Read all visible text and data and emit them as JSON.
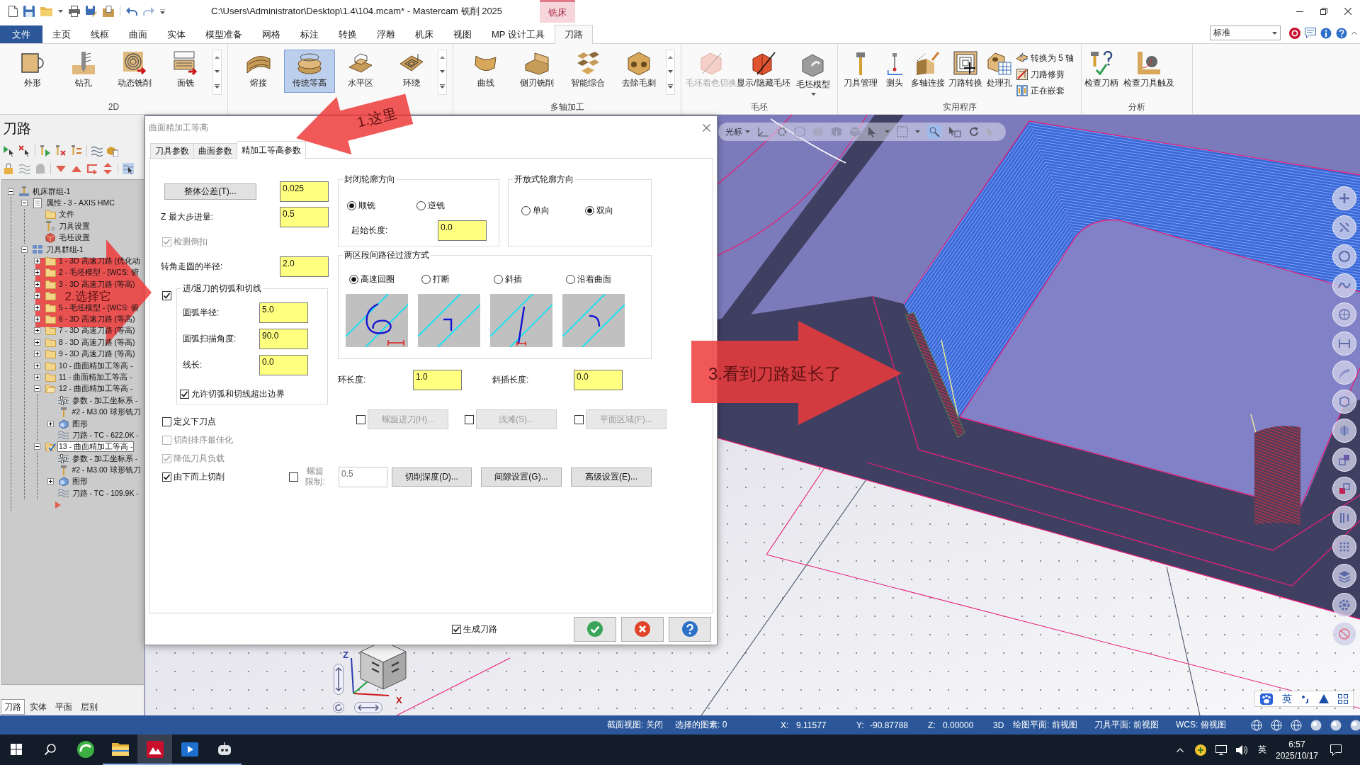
{
  "title_bar": {
    "title": "C:\\Users\\Administrator\\Desktop\\1.4\\104.mcam* - Mastercam 铣削 2025",
    "context_tab": "铣床"
  },
  "menu_tabs": [
    {
      "label": "文件",
      "kind": "file",
      "selected": false
    },
    {
      "label": "主页",
      "kind": "tab",
      "selected": false
    },
    {
      "label": "线框",
      "kind": "tab",
      "selected": false
    },
    {
      "label": "曲面",
      "kind": "tab",
      "selected": false
    },
    {
      "label": "实体",
      "kind": "tab",
      "selected": false
    },
    {
      "label": "模型准备",
      "kind": "tab",
      "selected": false
    },
    {
      "label": "网格",
      "kind": "tab",
      "selected": false
    },
    {
      "label": "标注",
      "kind": "tab",
      "selected": false
    },
    {
      "label": "转换",
      "kind": "tab",
      "selected": false
    },
    {
      "label": "浮雕",
      "kind": "tab",
      "selected": false
    },
    {
      "label": "机床",
      "kind": "tab",
      "selected": false
    },
    {
      "label": "视图",
      "kind": "tab",
      "selected": false
    },
    {
      "label": "MP 设计工具",
      "kind": "tab",
      "selected": false
    },
    {
      "label": "刀路",
      "kind": "tab",
      "selected": true
    }
  ],
  "workspace": {
    "value": "标准"
  },
  "ribbon": [
    {
      "label": "2D",
      "buttons": [
        {
          "label": "外形",
          "kind": "large",
          "selected": false,
          "disabled": false
        },
        {
          "label": "钻孔",
          "kind": "large",
          "selected": false,
          "disabled": false
        },
        {
          "label": "动态铣削",
          "kind": "large",
          "selected": false,
          "disabled": false
        },
        {
          "label": "面铣",
          "kind": "large",
          "selected": false,
          "disabled": false
        }
      ]
    },
    {
      "buttons": [
        {
          "label": "熔接",
          "kind": "large",
          "selected": false,
          "disabled": false
        },
        {
          "label": "传统等高",
          "kind": "large",
          "selected": true,
          "disabled": false
        },
        {
          "label": "水平区",
          "kind": "large",
          "selected": false,
          "disabled": false
        },
        {
          "label": "环绕",
          "kind": "large",
          "selected": false,
          "disabled": false
        }
      ]
    },
    {
      "label": "多轴加工",
      "buttons": [
        {
          "label": "曲线",
          "kind": "large",
          "selected": false,
          "disabled": false
        },
        {
          "label": "侧刃铣削",
          "kind": "large",
          "selected": false,
          "disabled": false
        },
        {
          "label": "智能综合",
          "kind": "large",
          "selected": false,
          "disabled": false
        },
        {
          "label": "去除毛刺",
          "kind": "large",
          "selected": false,
          "disabled": false
        }
      ]
    },
    {
      "label": "毛坯",
      "buttons": [
        {
          "label": "毛坯着色切换",
          "kind": "large",
          "selected": false,
          "disabled": true
        },
        {
          "label": "显示/隐藏毛坯",
          "kind": "large",
          "selected": false,
          "disabled": false
        },
        {
          "label": "毛坯模型",
          "kind": "split",
          "selected": false,
          "disabled": false
        }
      ]
    },
    {
      "label": "实用程序",
      "buttons": [
        {
          "label": "刀具管理",
          "kind": "large",
          "selected": false,
          "disabled": false
        },
        {
          "label": "测头",
          "kind": "large",
          "selected": false,
          "disabled": false
        },
        {
          "label": "多轴连接",
          "kind": "large",
          "selected": false,
          "disabled": false
        },
        {
          "label": "刀路转换",
          "kind": "large",
          "selected": false,
          "disabled": false
        },
        {
          "label": "处理孔",
          "kind": "large",
          "selected": false,
          "disabled": false
        },
        {
          "label": "转换为 5 轴",
          "kind": "small",
          "selected": false,
          "disabled": false
        },
        {
          "label": "刀路修剪",
          "kind": "small",
          "selected": false,
          "disabled": false
        },
        {
          "label": "正在嵌套",
          "kind": "small",
          "selected": false,
          "disabled": false
        }
      ]
    },
    {
      "label": "分析",
      "buttons": [
        {
          "label": "检查刀柄",
          "kind": "large",
          "selected": false,
          "disabled": false
        },
        {
          "label": "检查刀具触及",
          "kind": "large",
          "selected": false,
          "disabled": false
        }
      ]
    }
  ],
  "toolpath_panel": {
    "title": "刀路",
    "tree": [
      {
        "label": "机床群组-1",
        "kind": "machine",
        "expanded": true,
        "children": [
          {
            "label": "属性 - 3 - AXIS HMC",
            "kind": "properties",
            "expanded": true,
            "children": [
              {
                "label": "文件",
                "kind": "folder"
              },
              {
                "label": "刀具设置",
                "kind": "tool_settings"
              },
              {
                "label": "毛坯设置",
                "kind": "stock"
              }
            ]
          },
          {
            "label": "刀具群组-1",
            "kind": "group",
            "expanded": true,
            "children": [
              {
                "label": "1 - 3D 高速刀路 (优化动",
                "kind": "operation",
                "expanded": false,
                "checked": false,
                "selected": false
              },
              {
                "label": "2 - 毛坯模型 - [WCS: 俯",
                "kind": "operation",
                "expanded": false,
                "checked": false,
                "selected": false
              },
              {
                "label": "3 - 3D 高速刀路 (等高)",
                "kind": "operation",
                "expanded": false,
                "checked": false,
                "selected": false
              },
              {
                "kind": "operation",
                "expanded": false,
                "checked": false,
                "selected": false
              },
              {
                "label": "5 - 毛坯模型 - [WCS: 俯",
                "kind": "operation",
                "expanded": false,
                "checked": false,
                "selected": false
              },
              {
                "label": "6 - 3D 高速刀路 (等高)",
                "kind": "operation",
                "expanded": false,
                "checked": false,
                "selected": false
              },
              {
                "label": "7 - 3D 高速刀路 (等高)",
                "kind": "operation",
                "expanded": false,
                "checked": false,
                "selected": false
              },
              {
                "label": "8 - 3D 高速刀路 (等高)",
                "kind": "operation",
                "expanded": false,
                "checked": false,
                "selected": false
              },
              {
                "label": "9 - 3D 高速刀路 (等高)",
                "kind": "operation",
                "expanded": false,
                "checked": false,
                "selected": false
              },
              {
                "label": "10 - 曲面精加工等高 -",
                "kind": "operation",
                "expanded": false,
                "checked": false,
                "selected": false
              },
              {
                "label": "11 - 曲面精加工等高 -",
                "kind": "operation",
                "expanded": false,
                "checked": false,
                "selected": false
              },
              {
                "label": "12 - 曲面精加工等高 -",
                "kind": "operation",
                "expanded": true,
                "checked": false,
                "selected": false,
                "children": [
                  {
                    "label": "参数 - 加工坐标系 -",
                    "kind": "params"
                  },
                  {
                    "label": "#2 - M3.00 球形铣刀",
                    "kind": "tool"
                  },
                  {
                    "label": "图形",
                    "kind": "geometry",
                    "expanded": false
                  },
                  {
                    "label": "刀路 - TC - 622.0K -",
                    "kind": "toolpath"
                  }
                ]
              },
              {
                "label": "13 - 曲面精加工等高 -",
                "kind": "operation",
                "expanded": true,
                "checked": true,
                "selected": true,
                "children": [
                  {
                    "label": "参数 - 加工坐标系 -",
                    "kind": "params"
                  },
                  {
                    "label": "#2 - M3.00 球形铣刀",
                    "kind": "tool"
                  },
                  {
                    "label": "图形",
                    "kind": "geometry",
                    "expanded": false
                  },
                  {
                    "label": "刀路 - TC - 109.9K -",
                    "kind": "toolpath"
                  }
                ]
              }
            ]
          }
        ]
      }
    ],
    "tabs": [
      {
        "label": "刀路",
        "selected": true
      },
      {
        "label": "实体",
        "selected": false
      },
      {
        "label": "平面",
        "selected": false
      },
      {
        "label": "层别",
        "selected": false
      }
    ]
  },
  "dialog": {
    "title": "曲面精加工等高",
    "tabs": [
      {
        "label": "刀具参数",
        "selected": false
      },
      {
        "label": "曲面参数",
        "selected": false
      },
      {
        "label": "精加工等高参数",
        "selected": true
      }
    ],
    "tolerance": {
      "button": "整体公差(T)...",
      "value": "0.025"
    },
    "max_stepdown": {
      "label": "Z 最大步进量:",
      "value": "0.5"
    },
    "detect_undercut": {
      "label": "检测倒扣",
      "checked": true,
      "disabled": true
    },
    "corner_radius": {
      "label": "转角走圆的半径:",
      "value": "2.0"
    },
    "entry_exit": {
      "checked": true,
      "title": "进/退刀的切弧和切线",
      "fields": [
        {
          "label": "圆弧半径:",
          "value": "5.0"
        },
        {
          "label": "圆弧扫描角度:",
          "value": "90.0"
        },
        {
          "label": "线长:",
          "value": "0.0"
        }
      ],
      "allow_overrun": {
        "label": "允许切弧和切线超出边界",
        "checked": true
      }
    },
    "options": [
      {
        "label": "定义下刀点",
        "checked": false,
        "disabled": false
      },
      {
        "label": "切削排序最佳化",
        "checked": false,
        "disabled": true
      },
      {
        "label": "降低刀具负载",
        "checked": true,
        "disabled": true
      }
    ],
    "bottom_up": {
      "label": "由下而上切削",
      "checked": true
    },
    "helix_limit": {
      "checked": false,
      "label": "螺旋限制:",
      "value": "0.5",
      "disabled": true
    },
    "setting_buttons": [
      "切削深度(D)...",
      "间隙设置(G)...",
      "高级设置(E)..."
    ],
    "closed_contour": {
      "title": "封闭轮廓方向",
      "options": [
        {
          "label": "顺铣",
          "selected": true
        },
        {
          "label": "逆铣",
          "selected": false
        }
      ],
      "start_length": {
        "label": "起始长度:",
        "value": "0.0"
      }
    },
    "open_contour": {
      "title": "开放式轮廓方向",
      "options": [
        {
          "label": "单向",
          "selected": false
        },
        {
          "label": "双向",
          "selected": true
        }
      ]
    },
    "transition": {
      "title": "两区段间路径过渡方式",
      "options": [
        {
          "label": "高速回圈",
          "selected": true
        },
        {
          "label": "打断",
          "selected": false
        },
        {
          "label": "斜插",
          "selected": false
        },
        {
          "label": "沿着曲面",
          "selected": false
        }
      ]
    },
    "loop_length": {
      "label": "环长度:",
      "value": "1.0"
    },
    "ramp_length": {
      "label": "斜插长度:",
      "value": "0.0"
    },
    "feature_buttons": [
      {
        "label": "螺旋进刀(H)...",
        "checked": false,
        "disabled": true
      },
      {
        "label": "浅滩(S)...",
        "checked": false,
        "disabled": true
      },
      {
        "label": "平面区域(F)...",
        "checked": false,
        "disabled": true
      }
    ],
    "generate": {
      "label": "生成刀路",
      "checked": true
    }
  },
  "viewport": {
    "toolbar_label": "光标",
    "axis_labels": [
      "Z",
      "X"
    ]
  },
  "ime_bar": {
    "mode": "英"
  },
  "annotations": [
    {
      "label": "1.这里"
    },
    {
      "label": "2.选择它"
    },
    {
      "label": "3.看到刀路延长了"
    }
  ],
  "status_bar": {
    "section_view": "截面视图: 关闭",
    "selection": "选择的图素: 0",
    "coords": [
      {
        "axis": "X:",
        "value": "9.11577"
      },
      {
        "axis": "Y:",
        "value": "-90.87788"
      },
      {
        "axis": "Z:",
        "value": "0.00000"
      }
    ],
    "mode": "3D",
    "planes": [
      "绘图平面: 前视图",
      "刀具平面: 前视图",
      "WCS: 俯视图"
    ]
  },
  "taskbar": {
    "apps": [
      {
        "running": false,
        "active": false
      },
      {
        "running": true,
        "active": false
      },
      {
        "running": true,
        "active": true
      },
      {
        "running": true,
        "active": false
      },
      {
        "running": true,
        "active": false
      }
    ],
    "ime": "英",
    "time": "6:57",
    "date": "2025/10/17"
  }
}
